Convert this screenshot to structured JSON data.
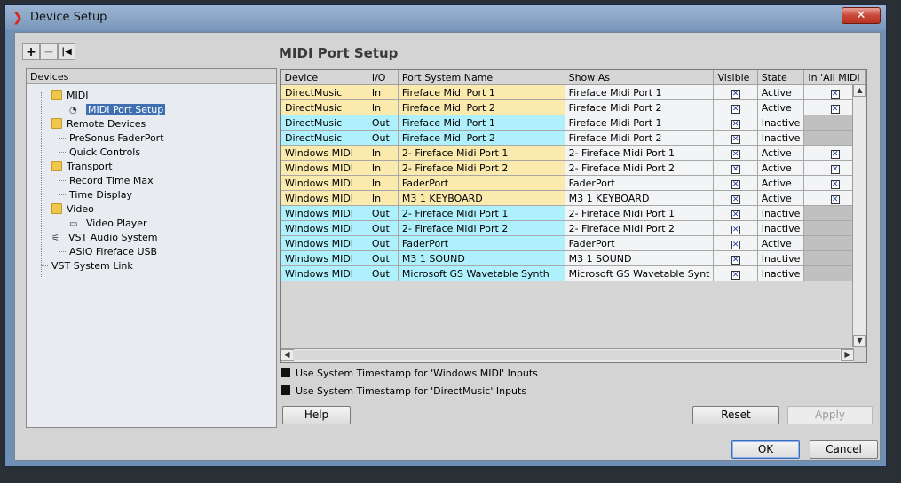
{
  "window": {
    "title": "Device Setup",
    "close_glyph": "✕",
    "app_icon": "cubase-logo-icon"
  },
  "tree": {
    "toolbar": {
      "add": "+",
      "remove": "−",
      "reset": "|◀"
    },
    "header": "Devices",
    "items": [
      {
        "label": "MIDI",
        "icon": "folder-icon",
        "level": 1
      },
      {
        "label": "MIDI Port Setup",
        "icon": "midi-port-icon",
        "level": 2,
        "selected": true
      },
      {
        "label": "Remote Devices",
        "icon": "folder-icon",
        "level": 1
      },
      {
        "label": "PreSonus FaderPort",
        "icon": "",
        "level": 2
      },
      {
        "label": "Quick Controls",
        "icon": "",
        "level": 2
      },
      {
        "label": "Transport",
        "icon": "folder-icon",
        "level": 1
      },
      {
        "label": "Record Time Max",
        "icon": "",
        "level": 2
      },
      {
        "label": "Time Display",
        "icon": "",
        "level": 2
      },
      {
        "label": "Video",
        "icon": "folder-icon",
        "level": 1
      },
      {
        "label": "Video Player",
        "icon": "video-player-icon",
        "level": 2
      },
      {
        "label": "VST Audio System",
        "icon": "audio-system-icon",
        "level": 1
      },
      {
        "label": "ASIO Fireface USB",
        "icon": "",
        "level": 2
      },
      {
        "label": "VST System Link",
        "icon": "",
        "level": 1
      }
    ]
  },
  "panel": {
    "title": "MIDI Port Setup",
    "columns": [
      "Device",
      "I/O",
      "Port System Name",
      "Show As",
      "Visible",
      "State",
      "In 'All MIDI"
    ],
    "rows": [
      {
        "device": "DirectMusic",
        "io": "In",
        "port": "Fireface Midi Port 1",
        "show_as": "Fireface Midi Port 1",
        "visible": true,
        "state": "Active",
        "all_midi": true
      },
      {
        "device": "DirectMusic",
        "io": "In",
        "port": "Fireface Midi Port 2",
        "show_as": "Fireface Midi Port 2",
        "visible": true,
        "state": "Active",
        "all_midi": true
      },
      {
        "device": "DirectMusic",
        "io": "Out",
        "port": "Fireface Midi Port 1",
        "show_as": "Fireface Midi Port 1",
        "visible": true,
        "state": "Inactive",
        "all_midi": null
      },
      {
        "device": "DirectMusic",
        "io": "Out",
        "port": "Fireface Midi Port 2",
        "show_as": "Fireface Midi Port 2",
        "visible": true,
        "state": "Inactive",
        "all_midi": null
      },
      {
        "device": "Windows MIDI",
        "io": "In",
        "port": "2- Fireface Midi Port 1",
        "show_as": "2- Fireface Midi Port 1",
        "visible": true,
        "state": "Active",
        "all_midi": true
      },
      {
        "device": "Windows MIDI",
        "io": "In",
        "port": "2- Fireface Midi Port 2",
        "show_as": "2- Fireface Midi Port 2",
        "visible": true,
        "state": "Active",
        "all_midi": true
      },
      {
        "device": "Windows MIDI",
        "io": "In",
        "port": "FaderPort",
        "show_as": "FaderPort",
        "visible": true,
        "state": "Active",
        "all_midi": true
      },
      {
        "device": "Windows MIDI",
        "io": "In",
        "port": "M3 1 KEYBOARD",
        "show_as": "M3 1 KEYBOARD",
        "visible": true,
        "state": "Active",
        "all_midi": true
      },
      {
        "device": "Windows MIDI",
        "io": "Out",
        "port": "2- Fireface Midi Port 1",
        "show_as": "2- Fireface Midi Port 1",
        "visible": true,
        "state": "Inactive",
        "all_midi": null
      },
      {
        "device": "Windows MIDI",
        "io": "Out",
        "port": "2- Fireface Midi Port 2",
        "show_as": "2- Fireface Midi Port 2",
        "visible": true,
        "state": "Inactive",
        "all_midi": null
      },
      {
        "device": "Windows MIDI",
        "io": "Out",
        "port": "FaderPort",
        "show_as": "FaderPort",
        "visible": true,
        "state": "Active",
        "all_midi": null
      },
      {
        "device": "Windows MIDI",
        "io": "Out",
        "port": "M3 1 SOUND",
        "show_as": "M3 1 SOUND",
        "visible": true,
        "state": "Inactive",
        "all_midi": null
      },
      {
        "device": "Windows MIDI",
        "io": "Out",
        "port": "Microsoft GS Wavetable Synth",
        "show_as": "Microsoft GS Wavetable Synt",
        "visible": true,
        "state": "Inactive",
        "all_midi": null
      }
    ],
    "options": [
      {
        "label": "Use System Timestamp for 'Windows MIDI' Inputs",
        "checked": true
      },
      {
        "label": "Use System Timestamp for 'DirectMusic' Inputs",
        "checked": true
      }
    ],
    "buttons": {
      "help": "Help",
      "reset": "Reset",
      "apply": "Apply"
    }
  },
  "footer": {
    "ok": "OK",
    "cancel": "Cancel"
  },
  "colors": {
    "input_row": "#fbeaae",
    "output_row": "#aef0fb",
    "window_frame": "#6f8fb4",
    "checkbox_mark": "#1c3ea8"
  }
}
